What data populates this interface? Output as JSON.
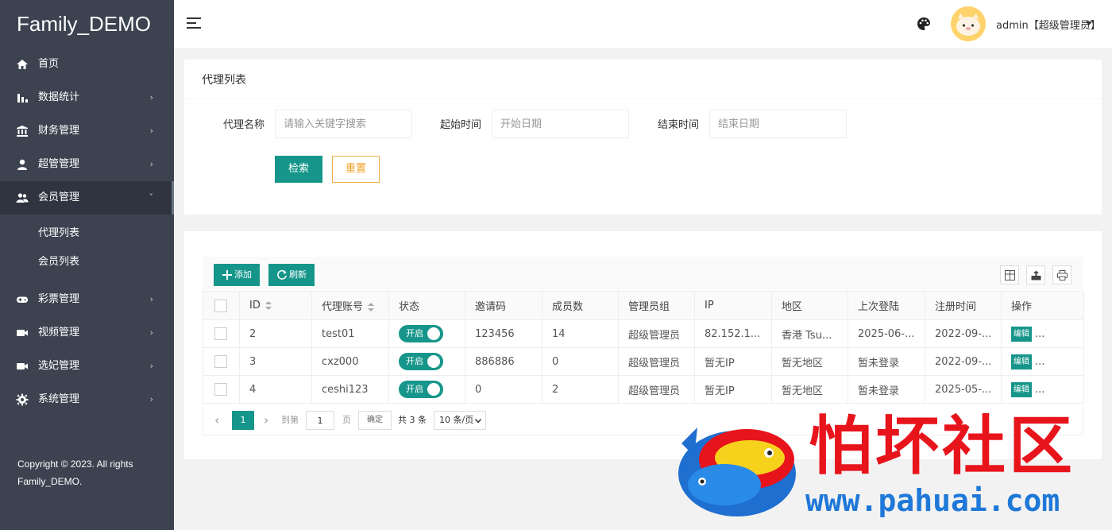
{
  "brand": "Family_DEMO",
  "sidebar": {
    "items": [
      {
        "label": "首页",
        "icon": "home-icon",
        "has_arrow": false
      },
      {
        "label": "数据统计",
        "icon": "bar-chart-icon",
        "has_arrow": true
      },
      {
        "label": "财务管理",
        "icon": "bank-icon",
        "has_arrow": true
      },
      {
        "label": "超管管理",
        "icon": "user-icon",
        "has_arrow": true
      },
      {
        "label": "会员管理",
        "icon": "users-icon",
        "has_arrow": true,
        "expanded": true
      },
      {
        "label": "彩票管理",
        "icon": "gamepad-icon",
        "has_arrow": true
      },
      {
        "label": "视频管理",
        "icon": "video-camera-icon",
        "has_arrow": true
      },
      {
        "label": "选妃管理",
        "icon": "video-camera-icon",
        "has_arrow": true
      },
      {
        "label": "系统管理",
        "icon": "gear-icon",
        "has_arrow": true
      }
    ],
    "subitems": [
      "代理列表",
      "会员列表"
    ],
    "arrow_right": "›",
    "arrow_down": "ˇ"
  },
  "copyright": "Copyright © 2023. All rights Family_DEMO.",
  "header": {
    "user": "admin【超级管理员】"
  },
  "search_card": {
    "title": "代理列表",
    "name_label": "代理名称",
    "name_placeholder": "请输入关键字搜索",
    "start_label": "起始时间",
    "start_placeholder": "开始日期",
    "end_label": "结束时间",
    "end_placeholder": "结束日期",
    "search_btn": "检索",
    "reset_btn": "重置"
  },
  "toolbar": {
    "add": "添加",
    "refresh": "刷新"
  },
  "table": {
    "headers": [
      "ID",
      "代理账号",
      "状态",
      "邀请码",
      "成员数",
      "管理员组",
      "IP",
      "地区",
      "上次登陆",
      "注册时间",
      "操作"
    ],
    "rows": [
      {
        "id": "2",
        "account": "test01",
        "status": "开启",
        "code": "123456",
        "members": "14",
        "group": "超级管理员",
        "ip": "82.152.1...",
        "region": "香港 Tsu...",
        "last_login": "2025-06-...",
        "reg": "2022-09-...",
        "edit": "编辑",
        "more": "..."
      },
      {
        "id": "3",
        "account": "cxz000",
        "status": "开启",
        "code": "886886",
        "members": "0",
        "group": "超级管理员",
        "ip": "暂无IP",
        "region": "暂无地区",
        "last_login": "暂未登录",
        "reg": "2022-09-...",
        "edit": "编辑",
        "more": "..."
      },
      {
        "id": "4",
        "account": "ceshi123",
        "status": "开启",
        "code": "0",
        "members": "2",
        "group": "超级管理员",
        "ip": "暂无IP",
        "region": "暂无地区",
        "last_login": "暂未登录",
        "reg": "2025-05-...",
        "edit": "编辑",
        "more": "..."
      }
    ]
  },
  "pager": {
    "prev": "‹",
    "current": "1",
    "next": "›",
    "goto_label": "到第",
    "goto_value": "1",
    "page_label": "页",
    "confirm": "确定",
    "total": "共 3 条",
    "page_size": "10 条/页"
  },
  "watermark": {
    "cn": "怕坏社区",
    "url": "www.pahuai.com"
  },
  "colors": {
    "sidebar_bg": "#3c4250",
    "accent": "#16968a",
    "reset": "#f0a020",
    "watermark_red": "#e8141c",
    "watermark_blue": "#1e78d8"
  }
}
